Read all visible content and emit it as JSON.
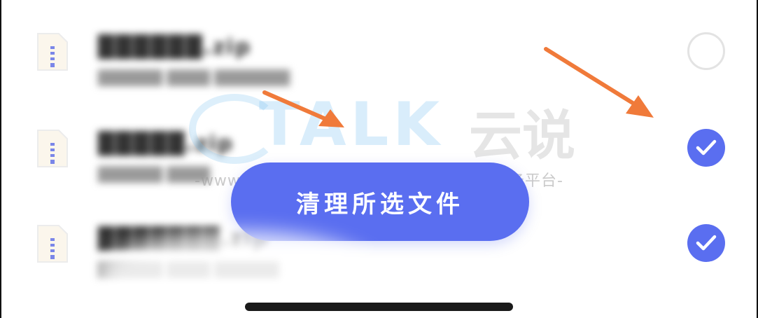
{
  "files": [
    {
      "name": "██████.zip",
      "meta": "██████ ████ ███████",
      "selected": false
    },
    {
      "name": "█████.zip",
      "meta": "██████ ████",
      "selected": true
    },
    {
      "name": "███████.zip",
      "meta": "██████ ████ ██████",
      "selected": true
    }
  ],
  "action": {
    "clean_label": "清理所选文件"
  },
  "watermark": {
    "logo": "TALK",
    "brand": "云说",
    "url": "-www.idctalk.com-国内专业云计算交流服务平台-"
  },
  "colors": {
    "accent": "#5a6ef0",
    "arrow": "#f07a3a"
  }
}
